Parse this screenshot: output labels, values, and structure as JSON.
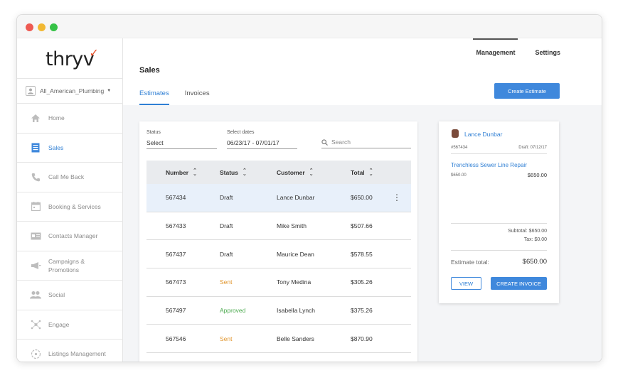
{
  "app": {
    "logo_text": "thryv",
    "account": "All_American_Plumbing"
  },
  "sidebar": {
    "items": [
      {
        "label": "Home",
        "icon": "home-icon",
        "active": false
      },
      {
        "label": "Sales",
        "icon": "document-icon",
        "active": true
      },
      {
        "label": "Call Me Back",
        "icon": "phone-icon",
        "active": false
      },
      {
        "label": "Booking & Services",
        "icon": "calendar-icon",
        "active": false
      },
      {
        "label": "Contacts Manager",
        "icon": "contact-card-icon",
        "active": false
      },
      {
        "label": "Campaigns &",
        "label2": "Promotions",
        "icon": "megaphone-icon",
        "active": false
      },
      {
        "label": "Social",
        "icon": "people-icon",
        "active": false
      },
      {
        "label": "Engage",
        "icon": "network-icon",
        "active": false
      },
      {
        "label": "Listings Management",
        "icon": "globe-icon",
        "active": false
      }
    ]
  },
  "topnav": {
    "management": "Management",
    "settings": "Settings"
  },
  "page": {
    "title": "Sales",
    "tabs": [
      {
        "label": "Estimates",
        "active": true
      },
      {
        "label": "Invoices",
        "active": false
      }
    ],
    "create_button": "Create Estimate"
  },
  "filters": {
    "status_label": "Status",
    "status_value": "Select",
    "dates_label": "Select dates",
    "dates_value": "06/23/17 - 07/01/17",
    "search_placeholder": "Search"
  },
  "table": {
    "headers": [
      "Number",
      "Status",
      "Customer",
      "Total"
    ],
    "rows": [
      {
        "number": "567434",
        "status": "Draft",
        "customer": "Lance Dunbar",
        "total": "$650.00",
        "selected": true
      },
      {
        "number": "567433",
        "status": "Draft",
        "customer": "Mike Smith",
        "total": "$507.66",
        "selected": false
      },
      {
        "number": "567437",
        "status": "Draft",
        "customer": "Maurice Dean",
        "total": "$578.55",
        "selected": false
      },
      {
        "number": "567473",
        "status": "Sent",
        "customer": "Tony Medina",
        "total": "$305.26",
        "selected": false
      },
      {
        "number": "567497",
        "status": "Approved",
        "customer": "Isabella Lynch",
        "total": "$375.26",
        "selected": false
      },
      {
        "number": "567546",
        "status": "Sent",
        "customer": "Belle Sanders",
        "total": "$870.90",
        "selected": false
      }
    ]
  },
  "detail": {
    "customer": "Lance Dunbar",
    "number": "#567434",
    "draft": "Draft: 07/12/17",
    "item_name": "Trenchless Sewer Line Repair",
    "item_sub": "$650.00",
    "item_amount": "$650.00",
    "subtotal": "Subtotal: $650.00",
    "tax": "Tax: $0.00",
    "total_label": "Estimate total:",
    "total_value": "$650.00",
    "view_button": "VIEW",
    "create_invoice_button": "CREATE INVOICE"
  },
  "colors": {
    "accent": "#3f88dc",
    "sent": "#e0952c",
    "approved": "#4caa4f",
    "brand_tick": "#e8502a"
  }
}
